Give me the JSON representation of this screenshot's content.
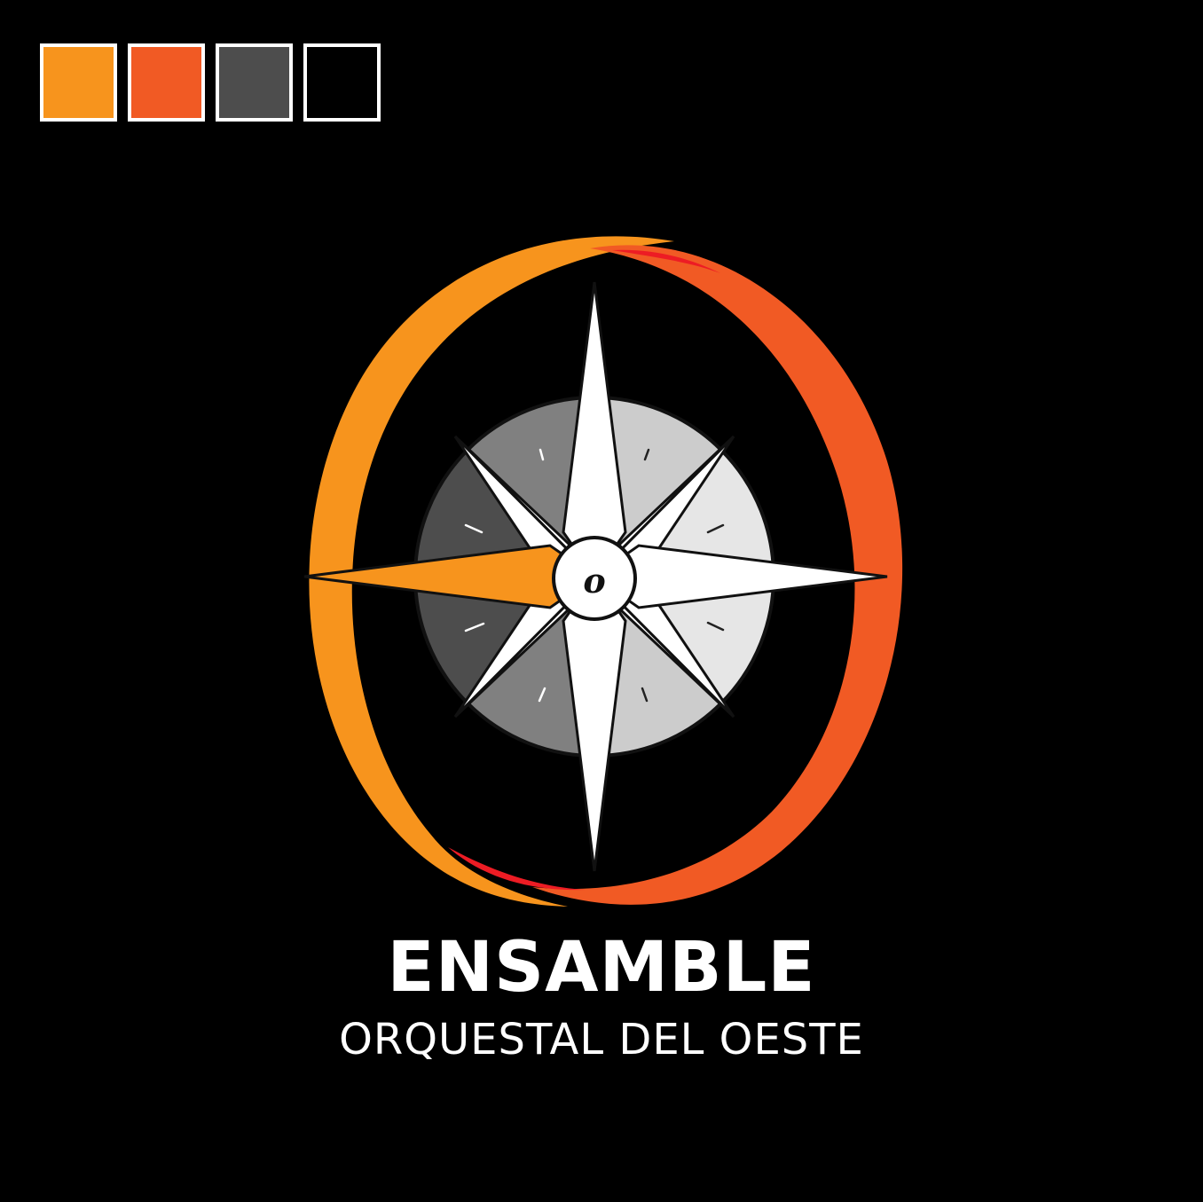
{
  "palette": {
    "swatches": [
      {
        "name": "orange",
        "color": "#F7941D"
      },
      {
        "name": "red-orange",
        "color": "#F15A24"
      },
      {
        "name": "dark-gray",
        "color": "#4D4D4D"
      },
      {
        "name": "black",
        "color": "#000000"
      }
    ]
  },
  "logo": {
    "emblem_icon": "compass-rose-icon",
    "center_letter": "o",
    "colors": {
      "ring_left": "#F7941D",
      "ring_right": "#F15A24",
      "ring_accent": "#ED1C24",
      "star": "#FFFFFF",
      "star_highlight": "#F7941D",
      "dial_dark": "#4D4D4D",
      "dial_mid": "#808080",
      "dial_light": "#CCCCCC",
      "dial_lightest": "#E6E6E6"
    },
    "title": "ENSAMBLE",
    "subtitle": "ORQUESTAL DEL OESTE"
  }
}
